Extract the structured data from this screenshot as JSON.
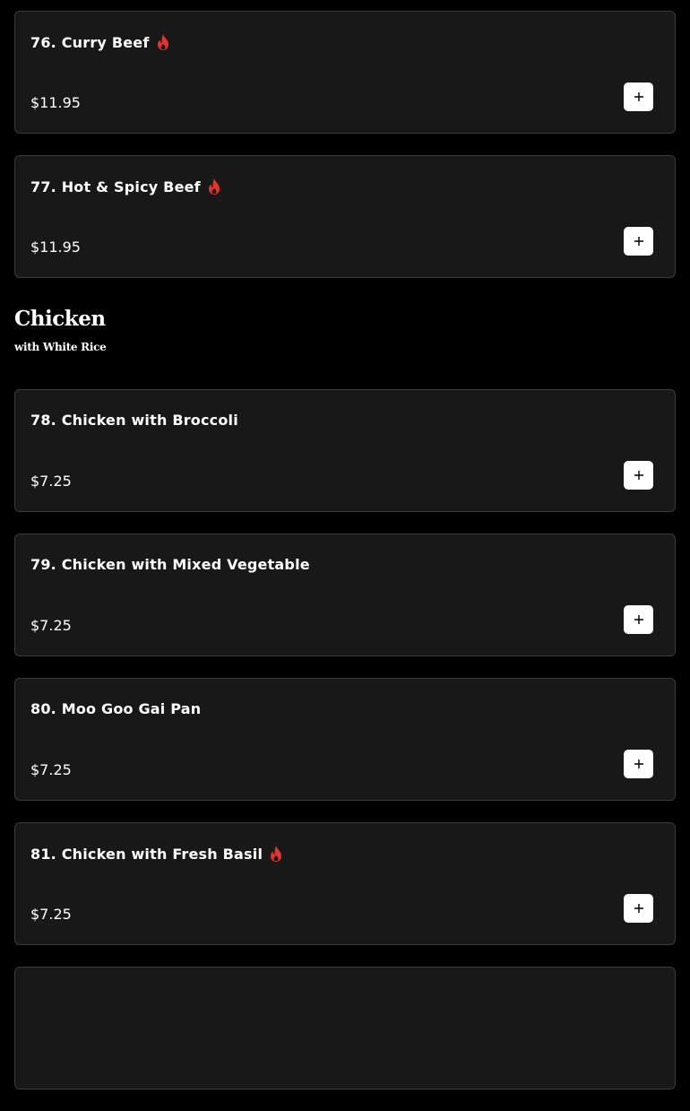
{
  "colors": {
    "background": "#000000",
    "card": "#181818",
    "card_border": "#3a3a3a",
    "spicy": "#e0342f",
    "button": "#ffffff"
  },
  "beef_items": [
    {
      "name": "76. Curry Beef",
      "price": "$11.95",
      "spicy": true
    },
    {
      "name": "77. Hot & Spicy Beef",
      "price": "$11.95",
      "spicy": true
    }
  ],
  "chicken_section": {
    "title": "Chicken",
    "subtitle": "with White Rice",
    "items": [
      {
        "name": "78. Chicken with Broccoli",
        "price": "$7.25",
        "spicy": false
      },
      {
        "name": "79. Chicken with Mixed Vegetable",
        "price": "$7.25",
        "spicy": false
      },
      {
        "name": "80. Moo Goo Gai Pan",
        "price": "$7.25",
        "spicy": false
      },
      {
        "name": "81. Chicken with Fresh Basil",
        "price": "$7.25",
        "spicy": true
      },
      {
        "name": "",
        "price": "",
        "spicy": false
      }
    ]
  },
  "icons": {
    "add": "plus-icon",
    "spicy": "flame-icon"
  }
}
